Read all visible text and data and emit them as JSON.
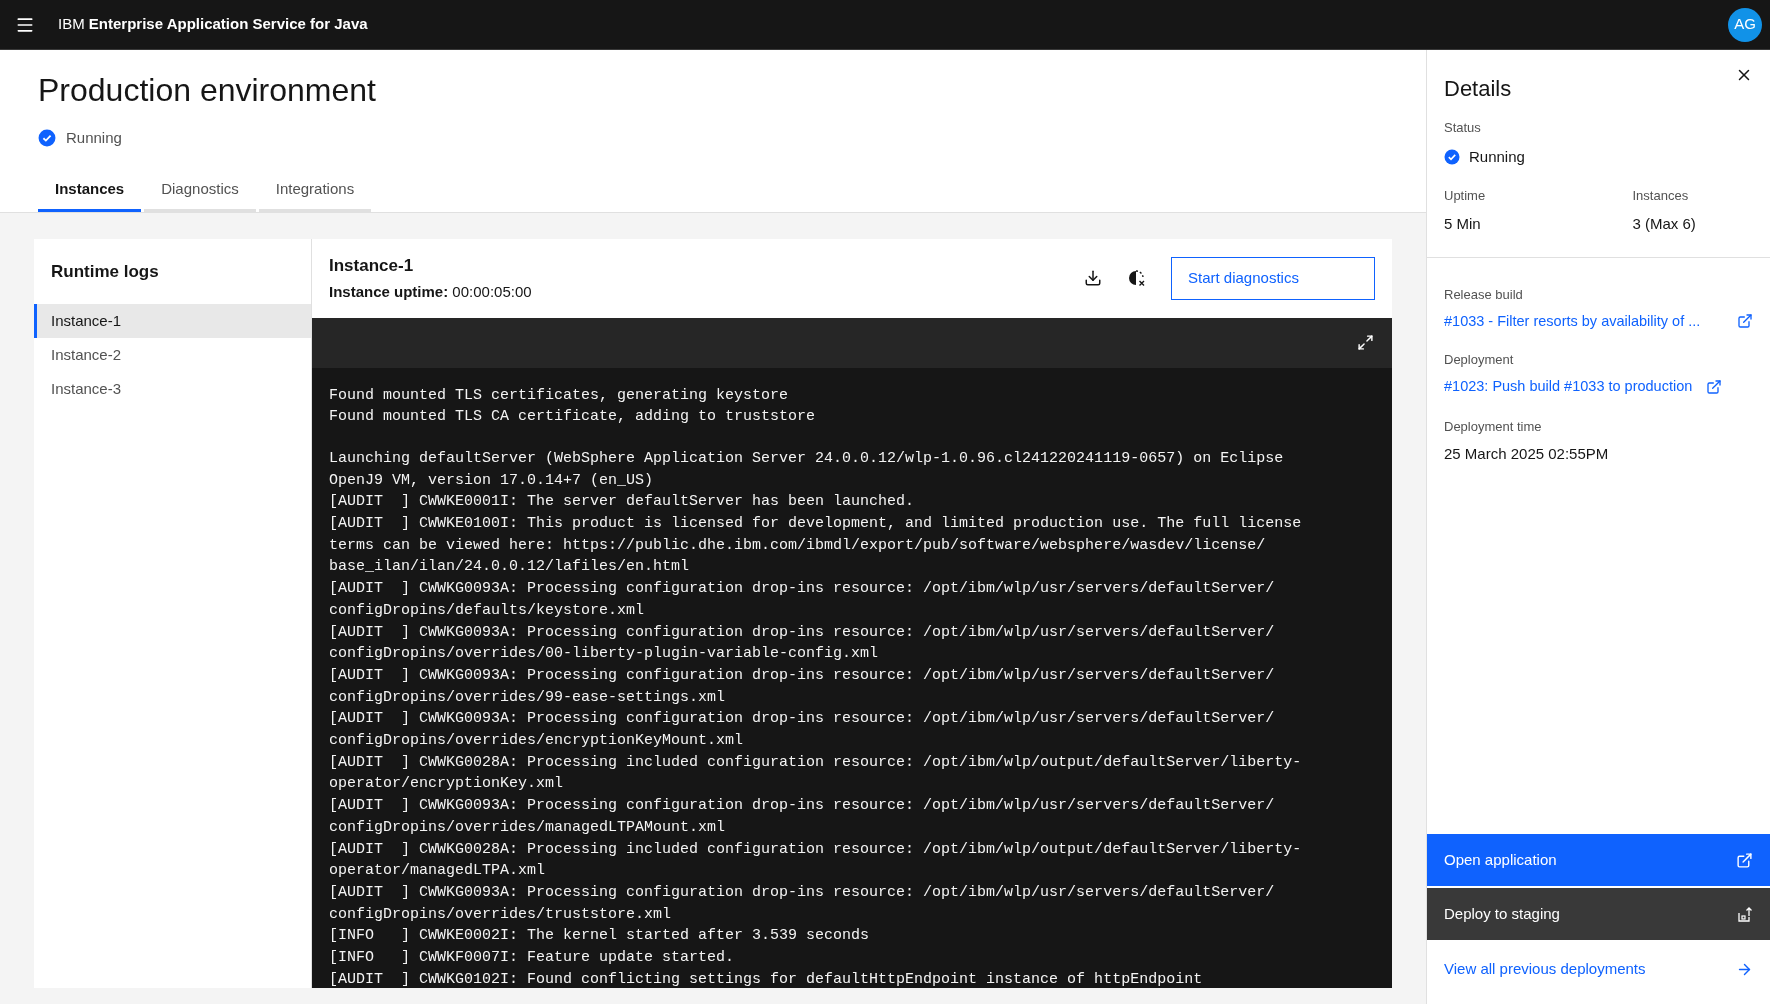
{
  "header": {
    "brand_prefix": "IBM",
    "product_name": "Enterprise Application Service for Java",
    "avatar_initials": "AG"
  },
  "page": {
    "title": "Production environment",
    "status": "Running"
  },
  "tabs": [
    {
      "label": "Instances",
      "selected": true
    },
    {
      "label": "Diagnostics",
      "selected": false
    },
    {
      "label": "Integrations",
      "selected": false
    }
  ],
  "runtime_logs": {
    "title": "Runtime logs",
    "items": [
      {
        "label": "Instance-1",
        "selected": true
      },
      {
        "label": "Instance-2",
        "selected": false
      },
      {
        "label": "Instance-3",
        "selected": false
      }
    ]
  },
  "instance": {
    "name": "Instance-1",
    "uptime_label": "Instance uptime:",
    "uptime": "00:00:05:00",
    "action_button": "Start diagnostics"
  },
  "log_blocks": [
    [
      "Found mounted TLS certificates, generating keystore",
      "Found mounted TLS CA certificate, adding to truststore"
    ],
    [
      "Launching defaultServer (WebSphere Application Server 24.0.0.12/wlp-1.0.96.cl241220241119-0657) on Eclipse",
      "OpenJ9 VM, version 17.0.14+7 (en_US)",
      "[AUDIT  ] CWWKE0001I: The server defaultServer has been launched.",
      "[AUDIT  ] CWWKE0100I: This product is licensed for development, and limited production use. The full license",
      "terms can be viewed here: https://public.dhe.ibm.com/ibmdl/export/pub/software/websphere/wasdev/license/",
      "base_ilan/ilan/24.0.0.12/lafiles/en.html",
      "[AUDIT  ] CWWKG0093A: Processing configuration drop-ins resource: /opt/ibm/wlp/usr/servers/defaultServer/",
      "configDropins/defaults/keystore.xml",
      "[AUDIT  ] CWWKG0093A: Processing configuration drop-ins resource: /opt/ibm/wlp/usr/servers/defaultServer/",
      "configDropins/overrides/00-liberty-plugin-variable-config.xml",
      "[AUDIT  ] CWWKG0093A: Processing configuration drop-ins resource: /opt/ibm/wlp/usr/servers/defaultServer/",
      "configDropins/overrides/99-ease-settings.xml",
      "[AUDIT  ] CWWKG0093A: Processing configuration drop-ins resource: /opt/ibm/wlp/usr/servers/defaultServer/",
      "configDropins/overrides/encryptionKeyMount.xml",
      "[AUDIT  ] CWWKG0028A: Processing included configuration resource: /opt/ibm/wlp/output/defaultServer/liberty-",
      "operator/encryptionKey.xml",
      "[AUDIT  ] CWWKG0093A: Processing configuration drop-ins resource: /opt/ibm/wlp/usr/servers/defaultServer/",
      "configDropins/overrides/managedLTPAMount.xml",
      "[AUDIT  ] CWWKG0028A: Processing included configuration resource: /opt/ibm/wlp/output/defaultServer/liberty-",
      "operator/managedLTPA.xml",
      "[AUDIT  ] CWWKG0093A: Processing configuration drop-ins resource: /opt/ibm/wlp/usr/servers/defaultServer/",
      "configDropins/overrides/truststore.xml",
      "[INFO   ] CWWKE0002I: The kernel started after 3.539 seconds",
      "[INFO   ] CWWKF0007I: Feature update started.",
      "[AUDIT  ] CWWKG0102I: Found conflicting settings for defaultHttpEndpoint instance of httpEndpoint"
    ]
  ],
  "details": {
    "title": "Details",
    "status_label": "Status",
    "status": "Running",
    "uptime_label": "Uptime",
    "uptime": "5 Min",
    "instances_label": "Instances",
    "instances": "3 (Max 6)",
    "release_build_label": "Release build",
    "release_build": "#1033 - Filter resorts by availability of ...",
    "deployment_label": "Deployment",
    "deployment": "#1023: Push build #1033 to production",
    "deployment_time_label": "Deployment time",
    "deployment_time": "25 March 2025 02:55PM",
    "primary_button": "Open application",
    "secondary_button": "Deploy to staging",
    "footer_link": "View all previous deployments"
  }
}
